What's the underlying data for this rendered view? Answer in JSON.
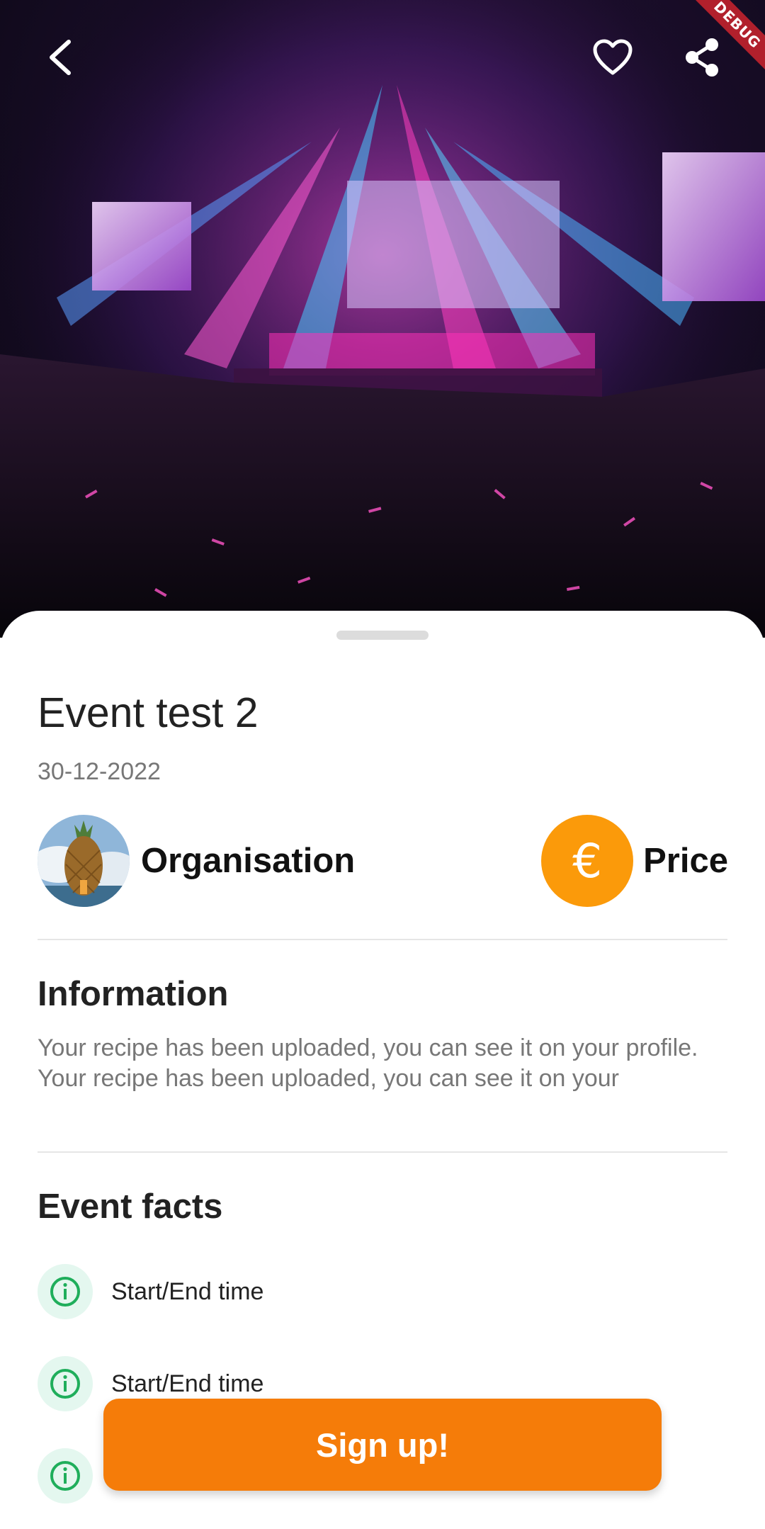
{
  "header": {
    "back_icon": "chevron-left-icon",
    "favorite_icon": "heart-outline-icon",
    "share_icon": "share-icon",
    "debug_banner": "DEBUG"
  },
  "event": {
    "title": "Event test 2",
    "date": "30-12-2022",
    "organisation_label": "Organisation",
    "price_label": "Price",
    "price_icon": "euro-icon",
    "price_symbol": "€"
  },
  "information": {
    "title": "Information",
    "text": "Your recipe has been uploaded, you can see it on your profile. Your recipe has been uploaded, you can see it on your"
  },
  "facts": {
    "title": "Event facts",
    "items": [
      {
        "icon": "info-icon",
        "label": "Start/End time"
      },
      {
        "icon": "info-icon",
        "label": "Start/End time"
      },
      {
        "icon": "info-icon",
        "label": ""
      }
    ]
  },
  "cta": {
    "label": "Sign up!"
  },
  "colors": {
    "accent": "#f57c09",
    "price_circle": "#fb9a0a",
    "fact_icon_bg": "#e4f7ef",
    "fact_icon": "#1fae5b",
    "debug_banner": "#b1202c"
  }
}
